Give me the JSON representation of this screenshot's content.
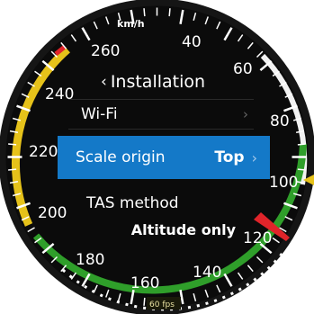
{
  "gauge": {
    "unit": "km/h",
    "scale_labels": [
      "260",
      "40",
      "60",
      "80",
      "100",
      "120",
      "140",
      "160",
      "180",
      "200",
      "220",
      "240"
    ],
    "fps_badge": "60 fps",
    "colors": {
      "face": "#0b0b0b",
      "yellow_arc": "#e6c21a",
      "green_arc": "#2f9e2a",
      "white_arc": "#f2f2f2",
      "needle": "#e0242a",
      "bug": "#e6c21a"
    }
  },
  "menu": {
    "title": "Installation",
    "back_icon": "chevron-left-icon",
    "items": [
      {
        "label": "Wi-Fi",
        "value": "",
        "icon": "chevron-right-icon",
        "selected": false
      },
      {
        "label": "Scale origin",
        "value": "Top",
        "icon": "chevron-right-icon",
        "selected": true
      },
      {
        "label": "TAS method",
        "value": "Altitude only",
        "selected": false
      }
    ]
  }
}
